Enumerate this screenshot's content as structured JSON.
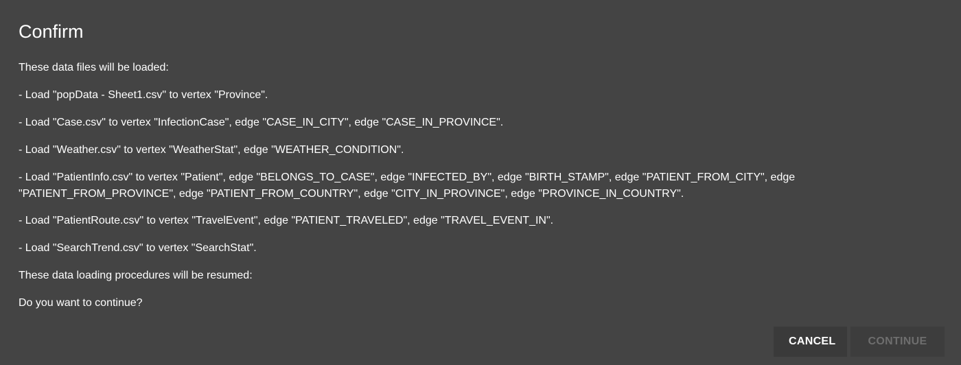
{
  "dialog": {
    "title": "Confirm",
    "intro": "These data files will be loaded:",
    "load_items": [
      "- Load \"popData - Sheet1.csv\" to vertex \"Province\".",
      "- Load \"Case.csv\" to vertex \"InfectionCase\", edge \"CASE_IN_CITY\", edge \"CASE_IN_PROVINCE\".",
      "- Load \"Weather.csv\" to vertex \"WeatherStat\", edge \"WEATHER_CONDITION\".",
      "- Load \"PatientInfo.csv\" to vertex \"Patient\", edge \"BELONGS_TO_CASE\", edge \"INFECTED_BY\", edge \"BIRTH_STAMP\", edge \"PATIENT_FROM_CITY\", edge \"PATIENT_FROM_PROVINCE\", edge \"PATIENT_FROM_COUNTRY\", edge \"CITY_IN_PROVINCE\", edge \"PROVINCE_IN_COUNTRY\".",
      "- Load \"PatientRoute.csv\" to vertex \"TravelEvent\", edge \"PATIENT_TRAVELED\", edge \"TRAVEL_EVENT_IN\".",
      "- Load \"SearchTrend.csv\" to vertex \"SearchStat\"."
    ],
    "resume_text": "These data loading procedures will be resumed:",
    "question": "Do you want to continue?",
    "cancel_label": "CANCEL",
    "continue_label": "CONTINUE",
    "continue_disabled": true
  },
  "colors": {
    "background": "#444444",
    "text": "#ffffff",
    "disabled_text": "#6e6e6e"
  }
}
